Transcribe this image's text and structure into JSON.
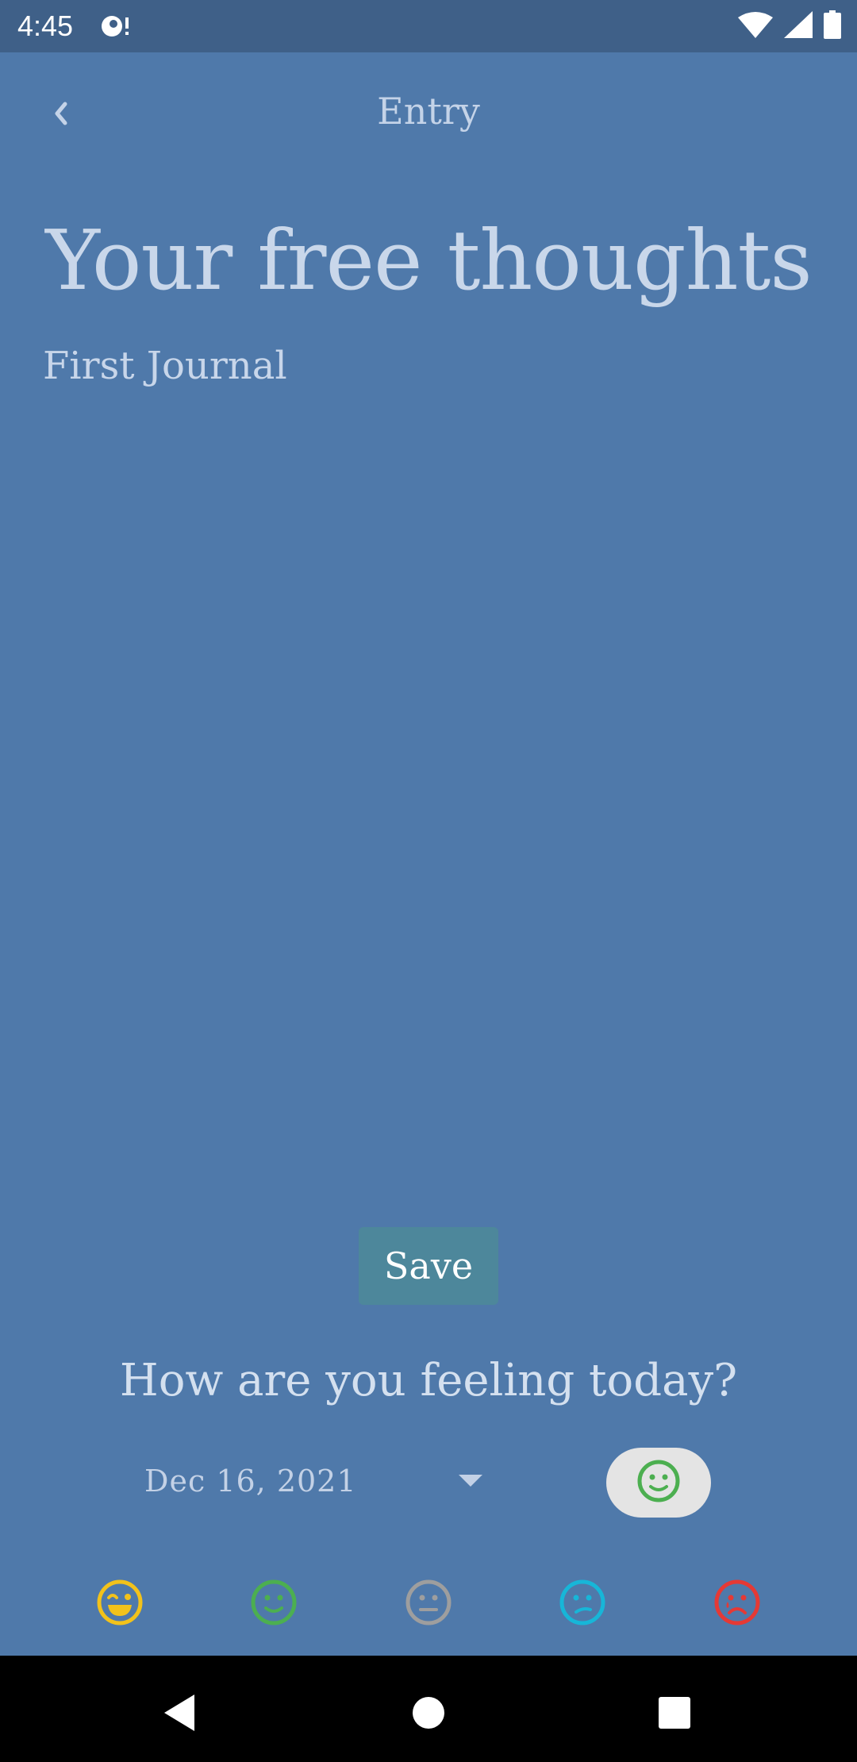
{
  "status_bar": {
    "time": "4:45",
    "icons": [
      "notification-icon",
      "wifi-icon",
      "signal-icon",
      "battery-icon"
    ]
  },
  "header": {
    "title": "Entry",
    "back_icon": "chevron-left-icon"
  },
  "hero": {
    "title": "Your free thoughts"
  },
  "journal": {
    "value": "First Journal"
  },
  "save_button": {
    "label": "Save"
  },
  "feeling": {
    "question": "How are you feeling today?"
  },
  "date_picker": {
    "value": "Dec 16, 2021",
    "icon": "dropdown-arrow-icon"
  },
  "selected_mood": {
    "icon": "smile-icon",
    "color": "#4caf50"
  },
  "moods": [
    {
      "name": "very-happy",
      "icon": "laugh-icon",
      "color": "#f2c21b"
    },
    {
      "name": "happy",
      "icon": "smile-icon",
      "color": "#4caf50"
    },
    {
      "name": "neutral",
      "icon": "neutral-face-icon",
      "color": "#9e9e9e"
    },
    {
      "name": "sad",
      "icon": "sad-face-icon",
      "color": "#17b6d8"
    },
    {
      "name": "very-sad",
      "icon": "crying-face-icon",
      "color": "#e53935"
    }
  ],
  "colors": {
    "background": "#4f79aa",
    "status_bar": "#3f6088",
    "save_button": "#4d879b",
    "mood_pill": "#e4e4e4"
  },
  "nav_bar": {
    "icons": [
      "back-icon",
      "home-icon",
      "recents-icon"
    ]
  }
}
